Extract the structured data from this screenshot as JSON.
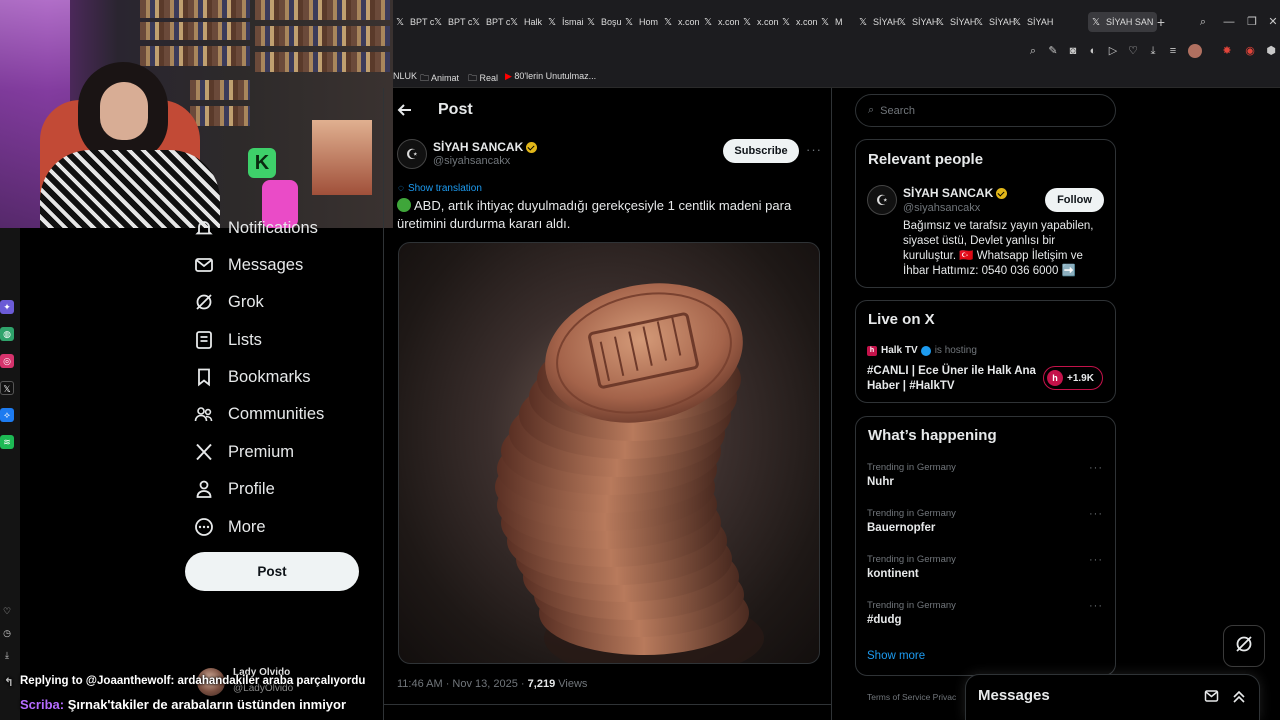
{
  "browser": {
    "tabs": [
      {
        "label": "BPT c"
      },
      {
        "label": "BPT c"
      },
      {
        "label": "BPT c"
      },
      {
        "label": "Halk"
      },
      {
        "label": "İsmai"
      },
      {
        "label": "Boşu"
      },
      {
        "label": "Hom"
      },
      {
        "label": "x.con"
      },
      {
        "label": "x.con"
      },
      {
        "label": "x.con"
      },
      {
        "label": "x.con"
      },
      {
        "label": "M"
      },
      {
        "label": "SİYAH"
      },
      {
        "label": "SİYAH"
      },
      {
        "label": "SİYAH"
      },
      {
        "label": "SİYAH"
      },
      {
        "label": "SİYAH"
      },
      {
        "label": "SİYAH SAN"
      }
    ],
    "bookmarks": [
      {
        "label": "NLUK"
      },
      {
        "label": "Animat"
      },
      {
        "label": "Real"
      },
      {
        "label": "80'lerin Unutulmaz..."
      }
    ]
  },
  "sidebar": {
    "items": [
      {
        "label": "Notifications"
      },
      {
        "label": "Messages"
      },
      {
        "label": "Grok"
      },
      {
        "label": "Lists"
      },
      {
        "label": "Bookmarks"
      },
      {
        "label": "Communities"
      },
      {
        "label": "Premium"
      },
      {
        "label": "Profile"
      },
      {
        "label": "More"
      }
    ],
    "post_label": "Post"
  },
  "post": {
    "header_title": "Post",
    "author_name": "SİYAH SANCAK",
    "author_handle": "@siyahsancakx",
    "subscribe_label": "Subscribe",
    "show_translation": "Show translation",
    "text": "ABD, artık ihtiyaç duyulmadığı gerekçesiyle 1 centlik madeni para üretimini durdurma kararı aldı.",
    "timestamp": "11:46 AM · Nov 13, 2025 · ",
    "views_count": "7,219",
    "views_label": " Views"
  },
  "search": {
    "placeholder": "Search"
  },
  "relevant_people": {
    "title": "Relevant people",
    "name": "SİYAH SANCAK",
    "handle": "@siyahsancakx",
    "follow_label": "Follow",
    "bio": "Bağımsız ve tarafsız yayın yapabilen, siyaset üstü, Devlet yanlısı bir kuruluştur. 🇹🇷 Whatsapp İletişim ve İhbar Hattımız: 0540 036 6000 ➡️"
  },
  "live": {
    "title": "Live on X",
    "host_name": "Halk TV",
    "host_status": "is hosting",
    "stream_title": "#CANLI | Ece Üner ile Halk Ana Haber | #HalkTV",
    "listener_count": "+1.9K"
  },
  "whats_happening": {
    "title": "What’s happening",
    "trends": [
      {
        "context": "Trending in Germany",
        "name": "Nuhr"
      },
      {
        "context": "Trending in Germany",
        "name": "Bauernopfer"
      },
      {
        "context": "Trending in Germany",
        "name": "kontinent"
      },
      {
        "context": "Trending in Germany",
        "name": "#dudg"
      }
    ],
    "show_more": "Show more"
  },
  "footer": {
    "links": "Terms of Service    Privac"
  },
  "messages_drawer": {
    "title": "Messages"
  },
  "chat": {
    "reply_line": "Replying to @Joaanthewolf: ardahandakiler araba parçalıyordu",
    "user_name": "Lady Olvido",
    "user_handle": "@LadyOlvido",
    "message_author": "Scriba:",
    "message_text": " Şırnak'takiler de arabaların üstünden inmiyor"
  },
  "colors": {
    "accent": "#1d9bf0",
    "background": "#000000",
    "verified_gold": "#e2b719",
    "live_red": "#c4124a"
  }
}
